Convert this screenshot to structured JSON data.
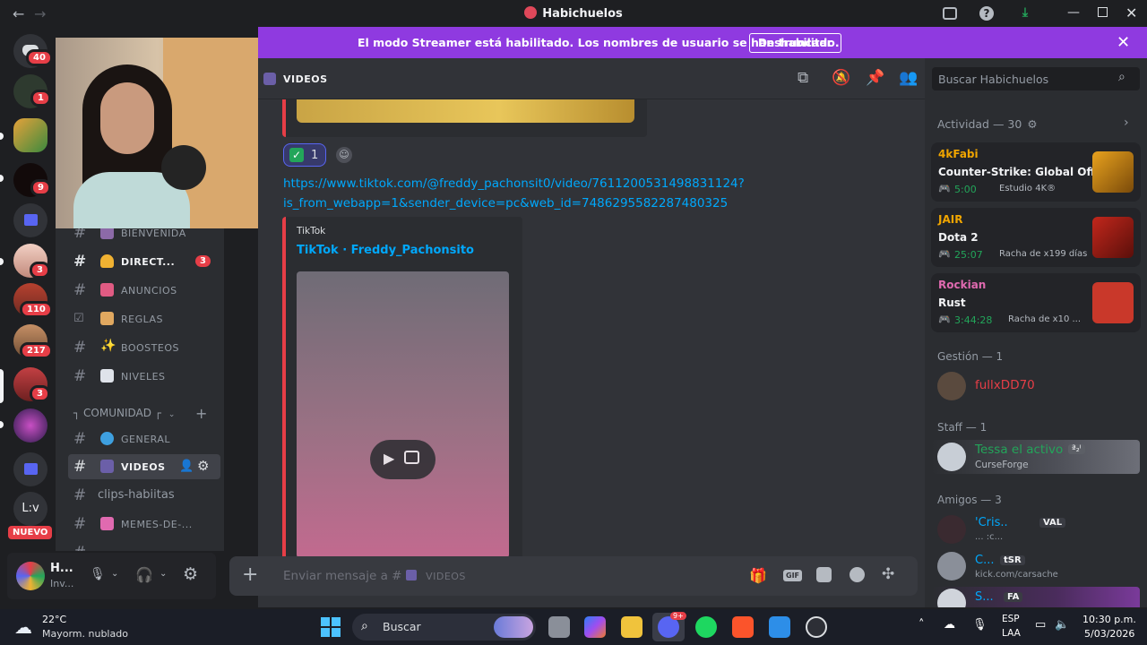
{
  "window": {
    "title": "Habichuelos"
  },
  "banner": {
    "message": "El modo Streamer está habilitado. Los nombres de usuario se han truncado.",
    "button": "Deshabilitar"
  },
  "rail": {
    "badges": [
      "40",
      "1",
      "9",
      "3",
      "110",
      "217",
      "3"
    ],
    "lv_label": "L:v",
    "new_label": "NUEVO"
  },
  "channels": {
    "items": [
      {
        "name": "BIENVENIDA"
      },
      {
        "name": "DIRECT...",
        "badge": "3"
      },
      {
        "name": "ANUNCIOS"
      },
      {
        "name": "REGLAS"
      },
      {
        "name": "BOOSTEOS"
      },
      {
        "name": "NIVELES"
      }
    ],
    "category": "┐ COMUNIDAD ┌",
    "items2": [
      {
        "name": "GENERAL"
      },
      {
        "name": "VIDEOS"
      },
      {
        "name": "clips-habiitas"
      },
      {
        "name": "MEMES-DE-..."
      }
    ]
  },
  "user": {
    "name": "H...",
    "status": "Inv..."
  },
  "chat": {
    "channel": "VIDEOS",
    "reaction_count": "1",
    "link_line1": "https://www.tiktok.com/@freddy_pachonsit0/video/7611200531498831124?",
    "link_line2": "is_from_webapp=1&sender_device=pc&web_id=7486295582287480325",
    "embed_provider": "TikTok",
    "embed_title": "TikTok · Freddy_Pachonsito",
    "input_placeholder": "Enviar mensaje a #",
    "input_channel": "VIDEOS",
    "search_placeholder": "Buscar Habichuelos"
  },
  "members": {
    "activity_header": "Actividad — 30",
    "activities": [
      {
        "user": "4kFabi",
        "game": "Counter-Strike: Global Off...",
        "time": "5:00",
        "extra": "Estudio 4K®"
      },
      {
        "user": "JAIR",
        "game": "Dota 2",
        "time": "25:07",
        "extra": "Racha de x199 días"
      },
      {
        "user": "Rockian",
        "game": "Rust",
        "time": "3:44:28",
        "extra": "Racha de x10 ..."
      }
    ],
    "gestion_header": "Gestión — 1",
    "gestion_user": "fullxDD70",
    "staff_header": "Staff — 1",
    "staff_user": "Tessa el activo",
    "staff_tag": "ª₂ᴵ",
    "staff_activity": "CurseForge",
    "friends_header": "Amigos — 3",
    "friends": [
      {
        "name": "'Cris..",
        "tag": "VAL",
        "sub": "... :c..."
      },
      {
        "name": "C...",
        "tag": "tSR",
        "sub": "kick.com/carsache"
      },
      {
        "name": "S...",
        "tag": "FA",
        "sub": ""
      }
    ]
  },
  "taskbar": {
    "weather_temp": "22°C",
    "weather_desc": "Mayorm. nublado",
    "search": "Buscar",
    "lang1": "ESP",
    "lang2": "LAA",
    "time": "10:30 p.m.",
    "date": "5/03/2026",
    "discord_badge": "9+"
  }
}
